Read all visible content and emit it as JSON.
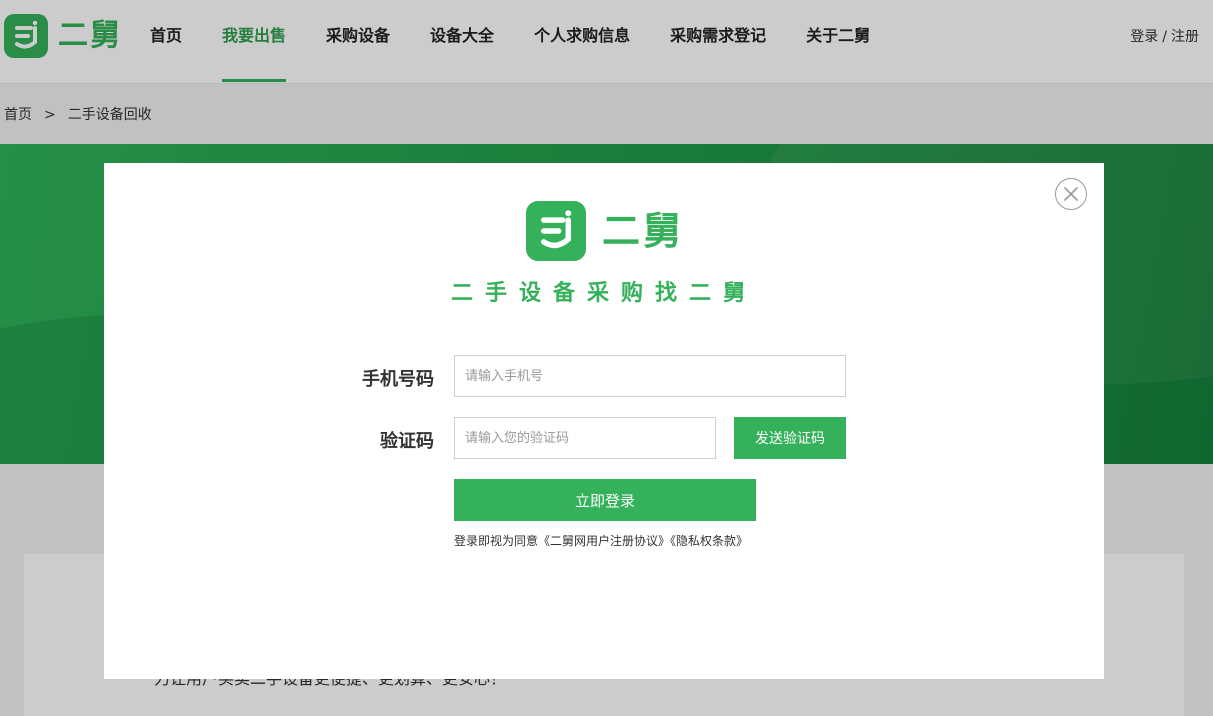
{
  "header": {
    "logo_text": "二舅",
    "nav": [
      {
        "label": "首页",
        "active": false
      },
      {
        "label": "我要出售",
        "active": true
      },
      {
        "label": "采购设备",
        "active": false
      },
      {
        "label": "设备大全",
        "active": false
      },
      {
        "label": "个人求购信息",
        "active": false
      },
      {
        "label": "采购需求登记",
        "active": false
      },
      {
        "label": "关于二舅",
        "active": false
      }
    ],
    "login_label": "登录",
    "auth_separator": "/",
    "register_label": "注册"
  },
  "breadcrumb": {
    "home": "首页",
    "separator": ">",
    "current": "二手设备回收"
  },
  "content": {
    "about_text": "力让用户买卖二手设备更便捷、更划算、更安心！"
  },
  "modal": {
    "logo_text": "二舅",
    "slogan": "二手设备采购找二舅",
    "phone_label": "手机号码",
    "phone_placeholder": "请输入手机号",
    "phone_value": "",
    "code_label": "验证码",
    "code_placeholder": "请输入您的验证码",
    "code_value": "",
    "send_code_label": "发送验证码",
    "login_label": "立即登录",
    "agreement_prefix": "登录即视为同意",
    "agreement_user": "《二舅网用户注册协议》",
    "agreement_privacy": "《隐私权条款》"
  },
  "colors": {
    "brand_green": "#34b15a",
    "nav_active": "#2f9e4f",
    "overlay": "rgba(0,0,0,0.2)"
  }
}
